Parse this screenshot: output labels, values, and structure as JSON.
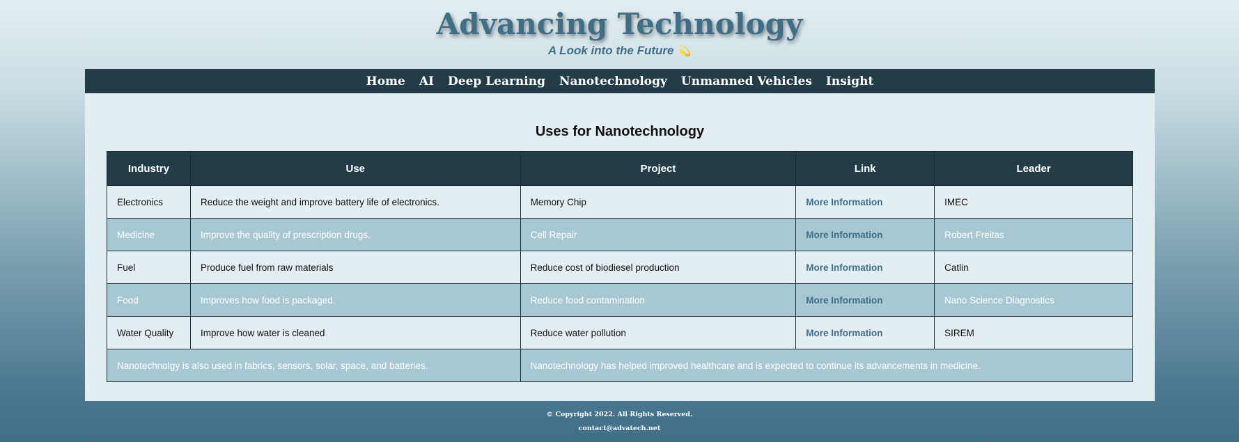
{
  "header": {
    "title": "Advancing Technology",
    "tagline": "A Look into the Future",
    "tagline_emoji": "💫"
  },
  "nav": {
    "items": [
      "Home",
      "AI",
      "Deep Learning",
      "Nanotechnology",
      "Unmanned Vehicles",
      "Insight"
    ]
  },
  "main": {
    "title": "Uses for Nanotechnology",
    "table": {
      "headers": [
        "Industry",
        "Use",
        "Project",
        "Link",
        "Leader"
      ],
      "rows": [
        {
          "industry": "Electronics",
          "use": "Reduce the weight and improve battery life of electronics.",
          "project": "Memory Chip",
          "link": "More Information",
          "leader": "IMEC"
        },
        {
          "industry": "Medicine",
          "use": "Improve the quality of prescription drugs.",
          "project": "Cell Repair",
          "link": "More Information",
          "leader": "Robert Freitas"
        },
        {
          "industry": "Fuel",
          "use": "Produce fuel from raw materials",
          "project": "Reduce cost of biodiesel production",
          "link": "More Information",
          "leader": "Catlin"
        },
        {
          "industry": "Food",
          "use": "Improves how food is packaged.",
          "project": "Reduce food contamination",
          "link": "More Information",
          "leader": "Nano Science Diagnostics"
        },
        {
          "industry": "Water Quality",
          "use": "Improve how water is cleaned",
          "project": "Reduce water pollution",
          "link": "More Information",
          "leader": "SIREM"
        }
      ],
      "footer_row": {
        "left": "Nanotechnolgy is also used in fabrics, sensors, solar, space, and batteries.",
        "right": "Nanotechnology has helped improved healthcare and is expected to continue its advancements in medicine."
      }
    }
  },
  "footer": {
    "copyright": "© Copyright 2022. All Rights Reserved.",
    "contact": "contact@advatech.net"
  },
  "colors": {
    "nav_bg": "#223d48",
    "accent": "#3f6f87",
    "row_alt": "#a7c8d3",
    "content_bg": "#e3eef2"
  }
}
